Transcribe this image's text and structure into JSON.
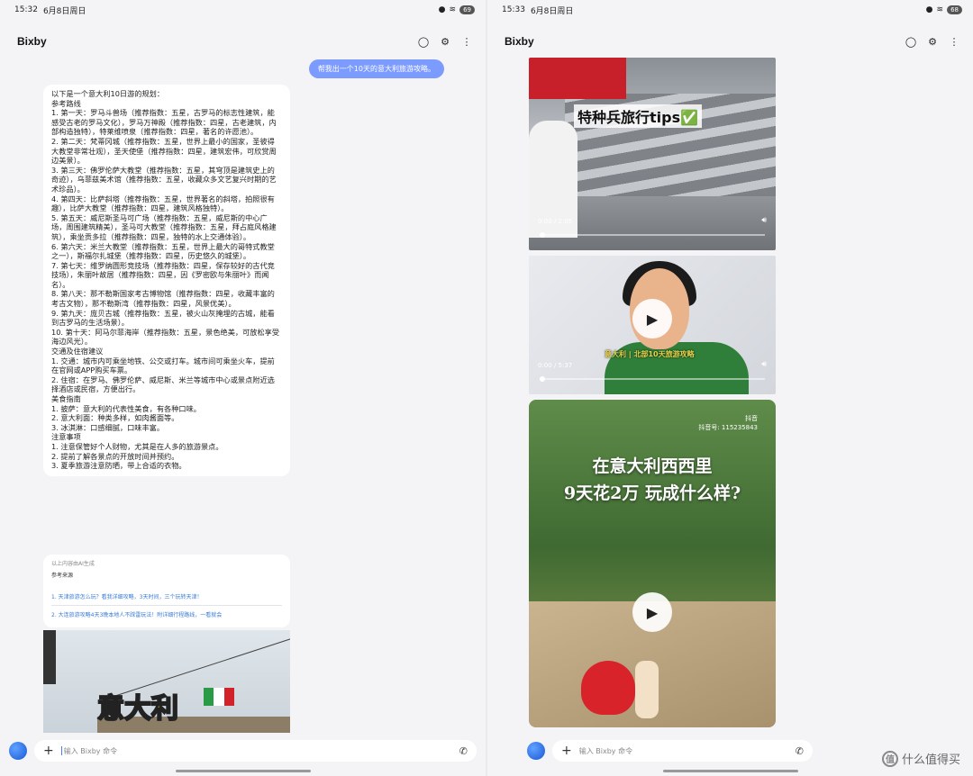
{
  "left": {
    "status": {
      "time": "15:32",
      "date": "6月8日周日",
      "battery": "69"
    },
    "app_title": "Bixby",
    "user_message": "帮我出一个10天的意大利旅游攻略。",
    "ai_response": "以下是一个意大利10日游的规划：\n参考路线\n1. 第一天：罗马斗兽场（推荐指数：五星，古罗马的标志性建筑，能感受古老的罗马文化），罗马万神殿（推荐指数：四星，古老建筑，内部构造独特），特莱维喷泉（推荐指数：四星，著名的许愿池）。\n2. 第二天：梵蒂冈城（推荐指数：五星，世界上最小的国家，圣彼得大教堂非常壮观），圣天使堡（推荐指数：四星，建筑宏伟，可欣赏周边美景）。\n3. 第三天：佛罗伦萨大教堂（推荐指数：五星，其穹顶是建筑史上的奇迹），乌菲兹美术馆（推荐指数：五星，收藏众多文艺复兴时期的艺术珍品）。\n4. 第四天：比萨斜塔（推荐指数：五星，世界著名的斜塔，拍照很有趣），比萨大教堂（推荐指数：四星，建筑风格独特）。\n5. 第五天：威尼斯圣马可广场（推荐指数：五星，威尼斯的中心广场，周围建筑精美），圣马可大教堂（推荐指数：五星，拜占庭风格建筑），乘坐贡多拉（推荐指数：四星，独特的水上交通体验）。\n6. 第六天：米兰大教堂（推荐指数：五星，世界上最大的哥特式教堂之一），斯福尔扎城堡（推荐指数：四星，历史悠久的城堡）。\n7. 第七天：维罗纳圆形竞技场（推荐指数：四星，保存较好的古代竞技场），朱丽叶故居（推荐指数：四星，因《罗密欧与朱丽叶》而闻名）。\n8. 第八天：那不勒斯国家考古博物馆（推荐指数：四星，收藏丰富的考古文物），那不勒斯湾（推荐指数：四星，风景优美）。\n9. 第九天：庞贝古城（推荐指数：五星，被火山灰掩埋的古城，能看到古罗马的生活场景）。\n10. 第十天：阿马尔菲海岸（推荐指数：五星，景色绝美，可放松享受海边风光）。\n交通及住宿建议\n1. 交通：城市内可乘坐地铁、公交或打车。城市间可乘坐火车，提前在官网或APP购买车票。\n2. 住宿：在罗马、佛罗伦萨、威尼斯、米兰等城市中心或景点附近选择酒店或民宿，方便出行。\n美食指南\n1. 披萨：意大利的代表性美食，有各种口味。\n2. 意大利面：种类多样，如肉酱面等。\n3. 冰淇淋：口感细腻，口味丰富。\n注意事项\n1. 注意保管好个人财物，尤其是在人多的旅游景点。\n2. 提前了解各景点的开放时间并预约。\n3. 夏季旅游注意防晒，带上合适的衣物。",
    "sources": {
      "note": "以上内容由AI生成",
      "heading": "参考来源",
      "links": [
        "1. 天津旅游怎么玩？看我详细攻略，3天时间，三个玩转天津！",
        "2. 大连旅游攻略4天3晚本地人不踩雷玩法！附详细行程路线，一看就会"
      ]
    },
    "thumbnail_text": "意大利",
    "input_placeholder": "输入 Bixby 命令"
  },
  "right": {
    "status": {
      "time": "15:33",
      "date": "6月8日周日",
      "battery": "68"
    },
    "app_title": "Bixby",
    "videos": [
      {
        "overlay": "特种兵旅行tips✅",
        "time": "0:00 / 2:05"
      },
      {
        "overlay": "意大利 | 北部10天旅游攻略",
        "time": "0:00 / 5:37"
      },
      {
        "overlay_line1": "在意大利西西里",
        "overlay_line2": "9天花2万 玩成什么样?",
        "tiktok_label": "抖音",
        "tiktok_id": "抖音号: 115235843"
      }
    ],
    "input_placeholder": "输入 Bixby 命令"
  },
  "watermark": "什么值得买",
  "colors": {
    "accent": "#7b9bff",
    "link": "#3a7bd5",
    "orb": "#1a56d6"
  }
}
